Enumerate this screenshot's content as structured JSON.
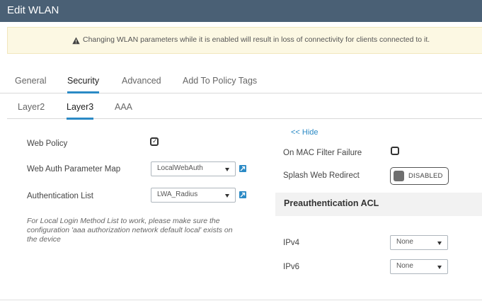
{
  "window": {
    "title": "Edit WLAN"
  },
  "warning": {
    "icon": "warning-triangle-icon",
    "text": "Changing WLAN parameters while it is enabled will result in loss of connectivity for clients connected to it."
  },
  "tabs": [
    {
      "label": "General",
      "active": false
    },
    {
      "label": "Security",
      "active": true
    },
    {
      "label": "Advanced",
      "active": false
    },
    {
      "label": "Add To Policy Tags",
      "active": false
    }
  ],
  "subtabs": [
    {
      "label": "Layer2",
      "active": false
    },
    {
      "label": "Layer3",
      "active": true
    },
    {
      "label": "AAA",
      "active": false
    }
  ],
  "left": {
    "web_policy": {
      "label": "Web Policy",
      "checked": true
    },
    "web_auth_param_map": {
      "label": "Web Auth Parameter Map",
      "value": "LocalWebAuth"
    },
    "authentication_list": {
      "label": "Authentication List",
      "value": "LWA_Radius"
    },
    "note": "For Local Login Method List to work, please make sure the configuration 'aaa authorization network default local' exists on the device"
  },
  "right": {
    "hide_link": "<< Hide",
    "on_mac_filter_failure": {
      "label": "On MAC Filter Failure",
      "checked": false
    },
    "splash_web_redirect": {
      "label": "Splash Web Redirect",
      "state": "DISABLED"
    },
    "preauth_section": "Preauthentication ACL",
    "ipv4": {
      "label": "IPv4",
      "value": "None"
    },
    "ipv6": {
      "label": "IPv6",
      "value": "None"
    }
  },
  "colors": {
    "titlebar": "#4a6075",
    "accent": "#2b8ac5",
    "warning_bg": "#fcf8e3"
  }
}
